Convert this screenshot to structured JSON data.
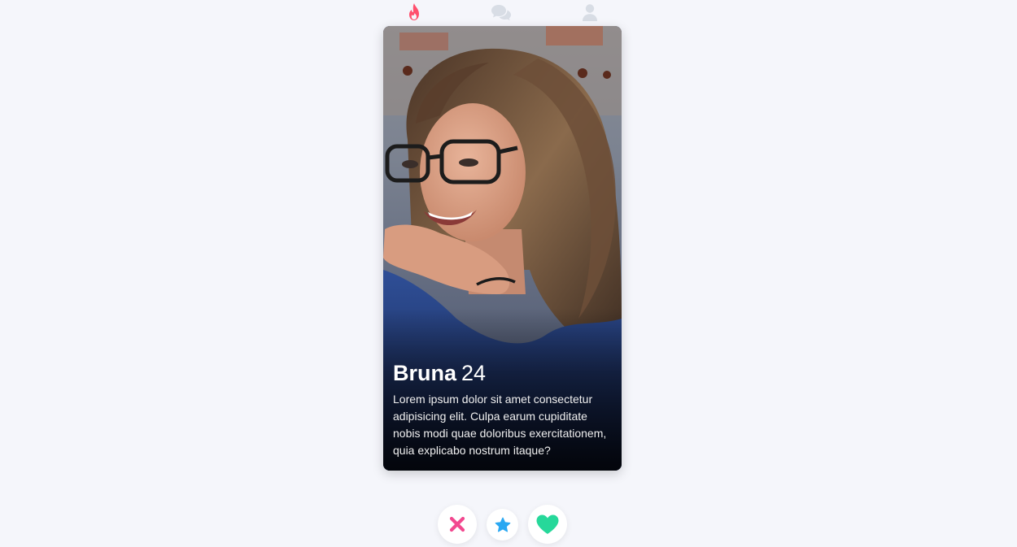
{
  "nav": {
    "items": [
      {
        "icon": "flame-icon",
        "color": "#ff4f6d",
        "active": true
      },
      {
        "icon": "chat-icon",
        "color": "#d8dde5",
        "active": false
      },
      {
        "icon": "user-icon",
        "color": "#d8dde5",
        "active": false
      }
    ]
  },
  "profile": {
    "name": "Bruna",
    "age": "24",
    "bio": "Lorem ipsum dolor sit amet consectetur adipisicing elit. Culpa earum cupiditate nobis modi quae doloribus exercitationem, quia explicabo nostrum itaque?"
  },
  "actions": [
    {
      "icon": "close-icon",
      "color": "#f2488f"
    },
    {
      "icon": "star-icon",
      "color": "#2aa8f2"
    },
    {
      "icon": "heart-icon",
      "color": "#26d89a"
    }
  ]
}
